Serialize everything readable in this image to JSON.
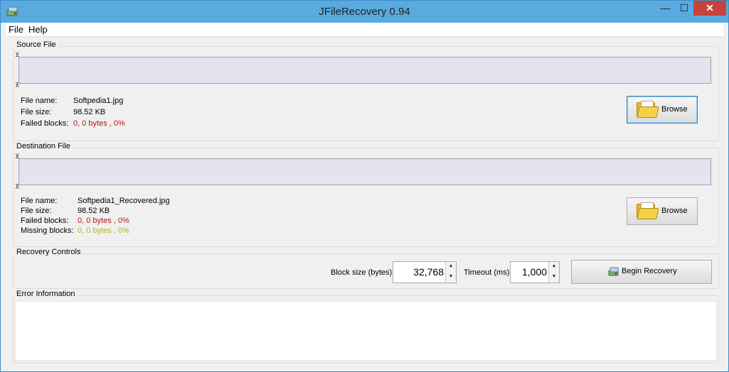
{
  "window": {
    "title": "JFileRecovery 0.94",
    "min_glyph": "—",
    "max_glyph": "☐",
    "close_glyph": "✕"
  },
  "menu": {
    "file": "File",
    "help": "Help"
  },
  "source": {
    "group_label": "Source File",
    "file_name_label": "File name:",
    "file_size_label": "File size:",
    "failed_blocks_label": "Failed blocks:",
    "file_name": "Softpedia1.jpg",
    "file_size": "98.52 KB",
    "failed_blocks": "0, 0 bytes , 0%",
    "browse_label": "Browse"
  },
  "destination": {
    "group_label": "Destination File",
    "file_name_label": "File name:",
    "file_size_label": "File size:",
    "failed_blocks_label": "Failed blocks:",
    "missing_blocks_label": "Missing blocks:",
    "file_name": "Softpedia1_Recovered.jpg",
    "file_size": "98.52 KB",
    "failed_blocks": "0, 0 bytes , 0%",
    "missing_blocks": "0, 0 bytes , 0%",
    "browse_label": "Browse"
  },
  "controls": {
    "group_label": "Recovery Controls",
    "block_size_label": "Block size (bytes)",
    "block_size_value": "32,768",
    "timeout_label": "Timeout (ms)",
    "timeout_value": "1,000",
    "begin_label": "Begin Recovery"
  },
  "errors": {
    "group_label": "Error Information"
  },
  "colors": {
    "failed": "#b01818",
    "missing": "#b4b428",
    "titlebar": "#5aaae0",
    "close": "#c7423c"
  },
  "icons": {
    "app": "app-disk-icon",
    "browse": "folder-icon",
    "begin": "recovery-disk-icon"
  }
}
